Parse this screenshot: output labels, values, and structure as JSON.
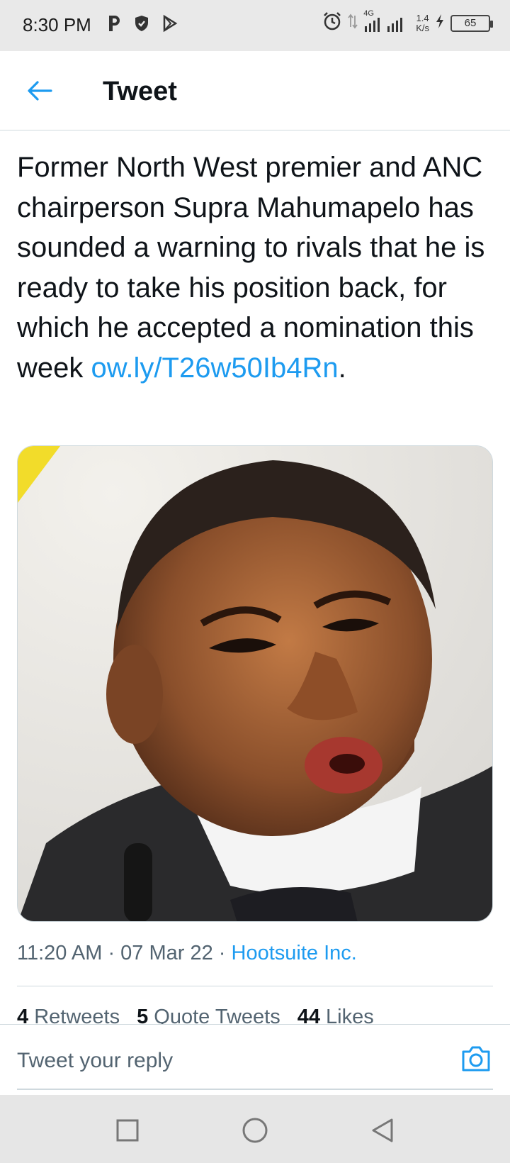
{
  "status_bar": {
    "time": "8:30 PM",
    "network": "4G",
    "speed_value": "1.4",
    "speed_unit": "K/s",
    "battery": "65",
    "icons": [
      "parking-app-icon",
      "shield-icon",
      "play-store-icon",
      "alarm-icon",
      "data-arrows-icon",
      "signal-icon",
      "charging-icon"
    ]
  },
  "header": {
    "title": "Tweet"
  },
  "tweet": {
    "text": "Former North West premier and ANC chairperson Supra Mahumapelo has sounded a warning to rivals that he is ready to take his position back, for which he accepted a nomination this week ",
    "link": "ow.ly/T26w50Ib4Rn",
    "text_end": ".",
    "time": "11:20 AM",
    "separator": " · ",
    "date": "07 Mar 22",
    "source": "Hootsuite Inc."
  },
  "stats": {
    "retweets_count": "4",
    "retweets_label": "Retweets",
    "quotes_count": "5",
    "quotes_label": "Quote Tweets",
    "likes_count": "44",
    "likes_label": "Likes"
  },
  "reply": {
    "placeholder": "Tweet your reply"
  },
  "colors": {
    "accent": "#1d9bf0",
    "text": "#0f1419",
    "secondary": "#536471"
  }
}
